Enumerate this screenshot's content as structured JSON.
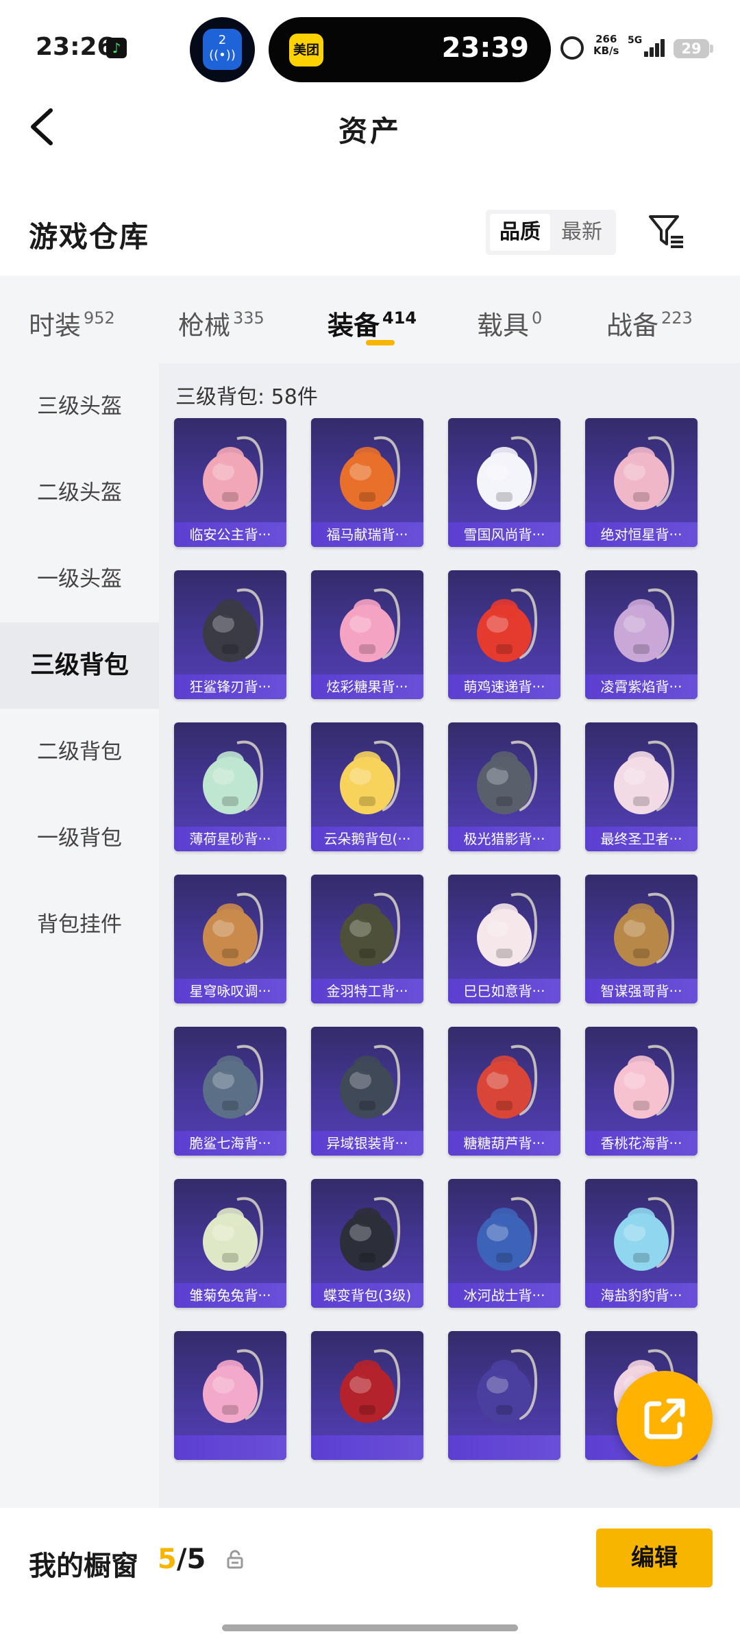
{
  "status_bar": {
    "time": "23:26",
    "bubble_number": "2",
    "island_app": "美团",
    "island_time": "23:39",
    "net_speed_value": "266",
    "net_speed_unit": "KB/s",
    "network": "5G",
    "battery": "29"
  },
  "header": {
    "title": "资产"
  },
  "warehouse": {
    "title": "游戏仓库",
    "sort_options": [
      "品质",
      "最新"
    ]
  },
  "tabs": [
    {
      "label": "时装",
      "count": "952"
    },
    {
      "label": "枪械",
      "count": "335"
    },
    {
      "label": "装备",
      "count": "414"
    },
    {
      "label": "载具",
      "count": "0"
    },
    {
      "label": "战备",
      "count": "223"
    }
  ],
  "sidebar": {
    "items": [
      "三级头盔",
      "二级头盔",
      "一级头盔",
      "三级背包",
      "二级背包",
      "一级背包",
      "背包挂件"
    ]
  },
  "content": {
    "header": "三级背包: 58件",
    "items": [
      {
        "name": "临安公主背···",
        "color": "#f2a7b6"
      },
      {
        "name": "福马献瑞背···",
        "color": "#e8702a"
      },
      {
        "name": "雪国风尚背···",
        "color": "#f4f4fb"
      },
      {
        "name": "绝对恒星背···",
        "color": "#f0b7c8"
      },
      {
        "name": "狂鲨锋刃背···",
        "color": "#3b3b46"
      },
      {
        "name": "炫彩糖果背···",
        "color": "#f5a3c2"
      },
      {
        "name": "萌鸡速递背···",
        "color": "#e53a2e"
      },
      {
        "name": "凌霄紫焰背···",
        "color": "#c9a7d6"
      },
      {
        "name": "薄荷星砂背···",
        "color": "#bfe6cf"
      },
      {
        "name": "云朵鹅背包(···",
        "color": "#f7d35c"
      },
      {
        "name": "极光猎影背···",
        "color": "#59606c"
      },
      {
        "name": "最终圣卫者···",
        "color": "#f3dbe6"
      },
      {
        "name": "星穹咏叹调···",
        "color": "#c98a4b"
      },
      {
        "name": "金羽特工背···",
        "color": "#4e5039"
      },
      {
        "name": "巳巳如意背···",
        "color": "#f5e7ea"
      },
      {
        "name": "智谋强哥背···",
        "color": "#b88849"
      },
      {
        "name": "脆鲨七海背···",
        "color": "#5b6f86"
      },
      {
        "name": "异域银装背···",
        "color": "#3f4958"
      },
      {
        "name": "糖糖葫芦背···",
        "color": "#d94536"
      },
      {
        "name": "香桃花海背···",
        "color": "#f6c2d0"
      },
      {
        "name": "雏菊兔兔背···",
        "color": "#dfe8c6"
      },
      {
        "name": "蝶变背包(3级)",
        "color": "#2c2f39"
      },
      {
        "name": "冰河战士背···",
        "color": "#3d63b8"
      },
      {
        "name": "海盐豹豹背···",
        "color": "#8fd6ee"
      },
      {
        "name": "",
        "color": "#f3a9c9"
      },
      {
        "name": "",
        "color": "#b4232b"
      },
      {
        "name": "",
        "color": "#4a3f9e"
      },
      {
        "name": "",
        "color": "#f2d3e0"
      }
    ]
  },
  "bottom_bar": {
    "label": "我的橱窗",
    "count_current": "5",
    "count_sep_total": "/5",
    "edit_label": "编辑"
  },
  "colors": {
    "accent": "#f7b500",
    "card": "#46379a"
  }
}
